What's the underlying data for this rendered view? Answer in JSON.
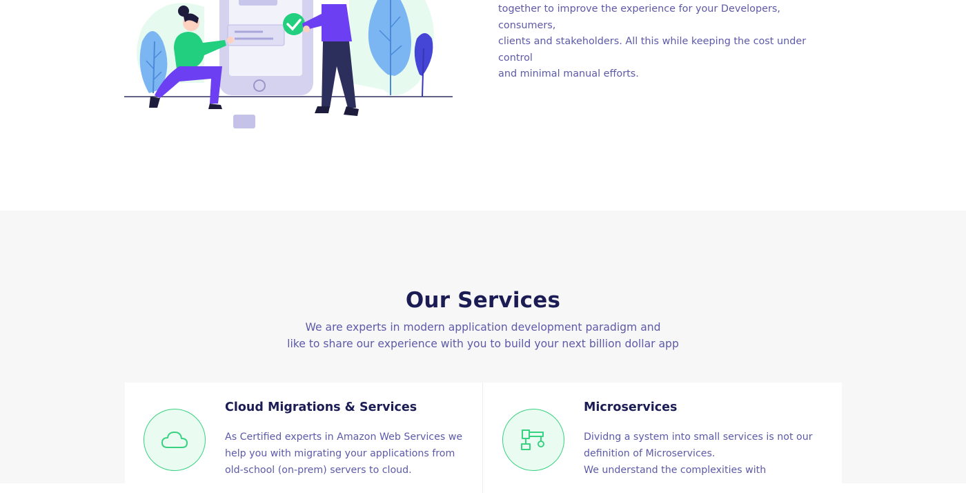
{
  "hero": {
    "paragraph_lines": [
      "together to improve the experience for your Developers, consumers,",
      "clients and stakeholders. All this while keeping the cost under control",
      "and minimal manual efforts."
    ]
  },
  "services": {
    "title": "Our Services",
    "subtitle_lines": [
      "We are experts in modern application development paradigm and",
      "like to share our experience with you to build your next billion dollar app"
    ],
    "cards": [
      {
        "icon": "cloud-icon",
        "title": "Cloud Migrations & Services",
        "lines": [
          "As Certified experts in Amazon Web Services we",
          "help you with migrating your applications from",
          "old-school (on-prem) servers to cloud."
        ]
      },
      {
        "icon": "microservices-icon",
        "title": "Microservices",
        "lines": [
          "Dividng a system into small services is not our",
          "definition of Microservices.",
          "We understand the complexities with"
        ]
      }
    ]
  },
  "colors": {
    "heading": "#1b1c54",
    "body_text": "#5c5aa8",
    "accent_green": "#37d27f",
    "section_bg": "#f7f7f7"
  }
}
